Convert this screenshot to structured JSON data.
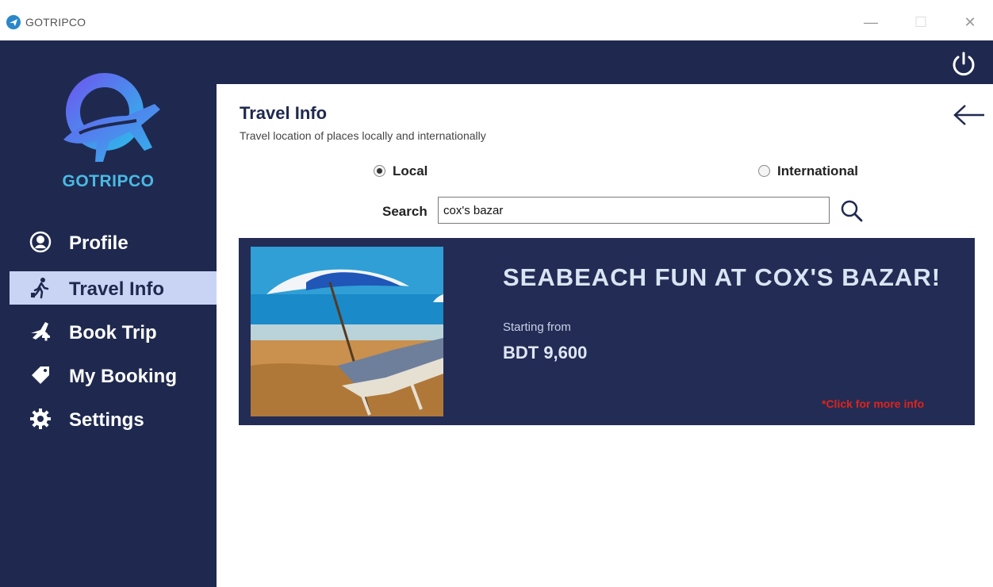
{
  "window": {
    "title": "GOTRIPCO",
    "minimize_glyph": "—",
    "maximize_glyph": "☐",
    "close_glyph": "✕"
  },
  "sidebar": {
    "brand": "GOTRIPCO",
    "items": [
      {
        "label": "Profile",
        "icon": "profile-icon",
        "active": false
      },
      {
        "label": "Travel Info",
        "icon": "hiker-icon",
        "active": true
      },
      {
        "label": "Book Trip",
        "icon": "plane-plus-icon",
        "active": false
      },
      {
        "label": "My Booking",
        "icon": "tag-icon",
        "active": false
      },
      {
        "label": "Settings",
        "icon": "gear-icon",
        "active": false
      }
    ]
  },
  "main": {
    "title": "Travel Info",
    "subtitle": "Travel location of places locally and internationally",
    "filters": {
      "local_label": "Local",
      "international_label": "International",
      "selected": "Local"
    },
    "search": {
      "label": "Search",
      "value": "cox's bazar"
    },
    "result_card": {
      "title": "SEABEACH FUN AT COX'S BAZAR!",
      "starting_label": "Starting from",
      "price": "BDT 9,600",
      "more_info": "*Click for more info"
    }
  },
  "colors": {
    "navy": "#1f294f",
    "card": "#232c55",
    "active_item": "#c9d4f5",
    "brand_blue": "#4bb9e3",
    "link_red": "#e0231b"
  }
}
